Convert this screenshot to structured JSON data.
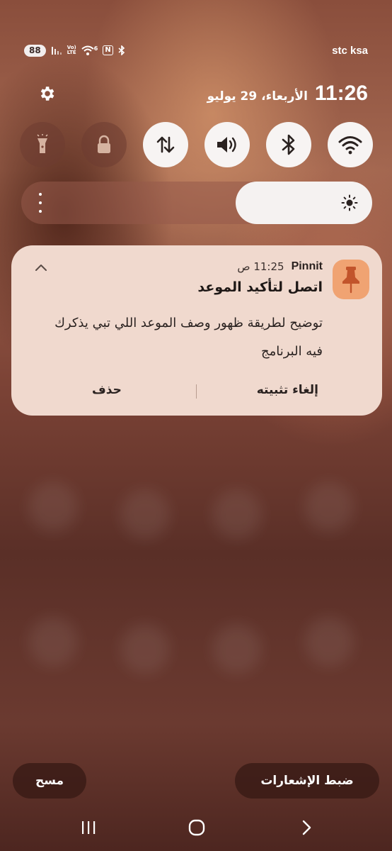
{
  "status_bar": {
    "battery": "88",
    "volte_top": "Vo)",
    "volte_bottom": "LTE",
    "wifi_band": "6",
    "nfc": "N",
    "carrier": "stc ksa",
    "icons": [
      "signal-icon",
      "volte-icon",
      "wifi-icon",
      "nfc-icon",
      "bluetooth-icon"
    ]
  },
  "header": {
    "time": "11:26",
    "date": "الأربعاء، 29 يوليو"
  },
  "quick_toggles": [
    {
      "name": "flashlight",
      "icon": "flashlight-icon",
      "on": false
    },
    {
      "name": "screen-lock",
      "icon": "lock-icon",
      "on": false
    },
    {
      "name": "mobile-data",
      "icon": "data-transfer-icon",
      "on": true
    },
    {
      "name": "sound",
      "icon": "volume-icon",
      "on": true
    },
    {
      "name": "bluetooth",
      "icon": "bluetooth-icon",
      "on": true
    },
    {
      "name": "wifi",
      "icon": "wifi-icon",
      "on": true
    }
  ],
  "brightness": {
    "level": 0.39
  },
  "notification": {
    "app_name": "Pinnit",
    "time": "11:25 ص",
    "title": "اتصل لتأكيد الموعد",
    "body": "توضيح لطريقة ظهور وصف الموعد اللي تبي يذكرك فيه البرنامج",
    "action_unpin": "إلغاء تثبيته",
    "action_delete": "حذف",
    "icon": "pin-icon"
  },
  "bottom": {
    "clear_label": "مسح",
    "settings_label": "ضبط الإشعارات"
  },
  "colors": {
    "card_bg": "#f0d9ce",
    "app_icon_bg": "#f0a372",
    "pin_color": "#c2542b"
  }
}
